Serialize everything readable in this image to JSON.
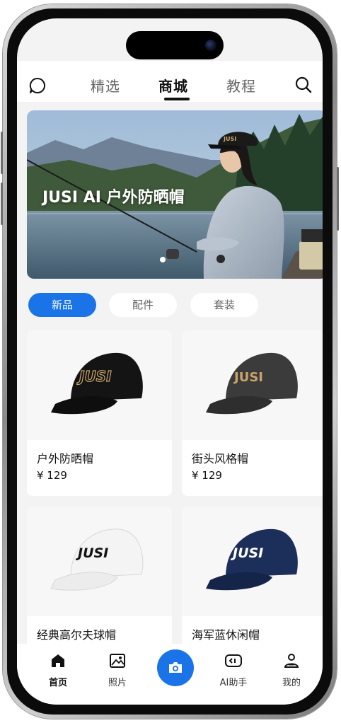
{
  "top_tabs": [
    {
      "label": "精选"
    },
    {
      "label": "商城"
    },
    {
      "label": "教程"
    }
  ],
  "banner": {
    "title": "JUSI AI 户外防晒帽"
  },
  "chips": [
    {
      "label": "新品"
    },
    {
      "label": "配件"
    },
    {
      "label": "套装"
    }
  ],
  "products": [
    {
      "name": "户外防晒帽",
      "price": "¥ 129",
      "logo": "JUSI"
    },
    {
      "name": "街头风格帽",
      "price": "¥ 129",
      "logo": "JUSI"
    },
    {
      "name": "经典高尔夫球帽",
      "logo": "JUSI"
    },
    {
      "name": "海军蓝休闲帽",
      "logo": "JUSI"
    }
  ],
  "bottom_nav": [
    {
      "label": "首页",
      "icon": "home-icon"
    },
    {
      "label": "照片",
      "icon": "photo-icon"
    },
    {
      "label": "",
      "icon": "camera-icon"
    },
    {
      "label": "AI助手",
      "icon": "ai-assistant-icon"
    },
    {
      "label": "我的",
      "icon": "profile-icon"
    }
  ],
  "colors": {
    "accent": "#1a74e8"
  }
}
